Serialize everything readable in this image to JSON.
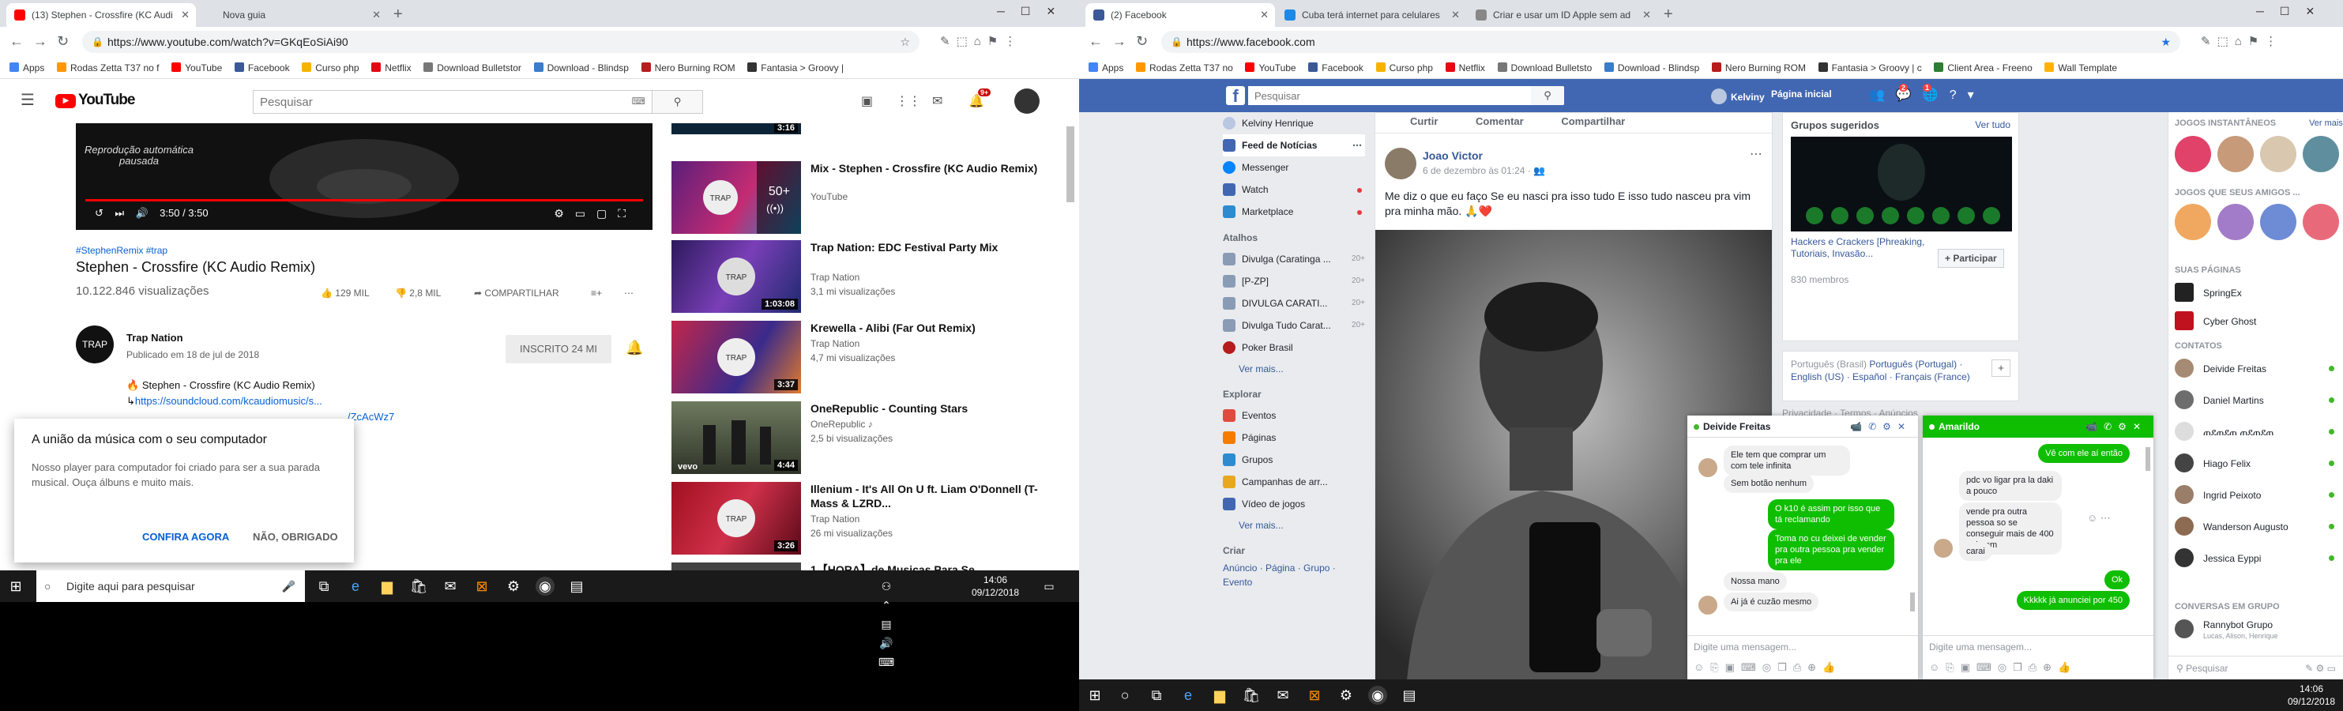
{
  "left_window": {
    "tabs": [
      {
        "label": "(13) Stephen - Crossfire (KC Audi",
        "active": true
      },
      {
        "label": "Nova guia",
        "active": false
      }
    ],
    "url": "https://www.youtube.com/watch?v=GKqEoSiAi90",
    "bookmarks": [
      "Apps",
      "Rodas Zetta T37 no f",
      "YouTube",
      "Facebook",
      "Curso php",
      "Netflix",
      "Download Bulletstor",
      "Download - Blindsp",
      "Nero Burning ROM",
      "Fantasia > Groovy |"
    ],
    "youtube": {
      "logo": "YouTube",
      "search_placeholder": "Pesquisar",
      "notifications": "9+",
      "player": {
        "autoplay_msg": "Reprodução automática pausada",
        "time": "3:50 / 3:50"
      },
      "hashtags": "#StephenRemix #trap",
      "title": "Stephen - Crossfire (KC Audio Remix)",
      "views": "10.122.846 visualizações",
      "likes": "129 MIL",
      "dislikes": "2,8 MIL",
      "share": "COMPARTILHAR",
      "channel": {
        "avatar_text": "TRAP",
        "name": "Trap Nation",
        "published": "Publicado em 18 de jul de 2018",
        "subscribe": "INSCRITO  24 MI"
      },
      "description": {
        "line1": "Stephen - Crossfire (KC Audio Remix)",
        "link1": "https://soundcloud.com/kcaudiomusic/s...",
        "link2": "/ZcAcWz7"
      },
      "recommendations": [
        {
          "title": "Mix - Stephen - Crossfire (KC Audio Remix)",
          "channel": "YouTube",
          "meta": "",
          "duration": "",
          "badge": "50+"
        },
        {
          "title": "Trap Nation: EDC Festival Party Mix",
          "channel": "Trap Nation",
          "meta": "3,1 mi visualizações",
          "duration": "1:03:08",
          "badge": ""
        },
        {
          "title": "Krewella - Alibi (Far Out Remix)",
          "channel": "Trap Nation",
          "meta": "4,7 mi visualizações",
          "duration": "3:37",
          "badge": ""
        },
        {
          "title": "OneRepublic - Counting Stars",
          "channel": "OneRepublic ♪",
          "meta": "2,5 bi visualizações",
          "duration": "4:44",
          "badge": ""
        },
        {
          "title": "Illenium - It's All On U ft. Liam O'Donnell (T-Mass & LZRD...",
          "channel": "Trap Nation",
          "meta": "26 mi visualizações",
          "duration": "3:26",
          "badge": ""
        },
        {
          "title": "1【HORA】de Musicas Para Se",
          "channel": "",
          "meta": "",
          "duration": "",
          "badge": ""
        }
      ],
      "top_duration": "3:16",
      "popup": {
        "title": "A união da música com o seu computador",
        "desc": "Nosso player para computador foi criado para ser a sua parada musical. Ouça álbuns e muito mais.",
        "confirm": "CONFIRA AGORA",
        "decline": "NÃO, OBRIGADO"
      }
    },
    "taskbar": {
      "search_placeholder": "Digite aqui para pesquisar",
      "time": "14:06",
      "date": "09/12/2018"
    }
  },
  "right_window": {
    "tabs": [
      {
        "label": "(2) Facebook",
        "active": true
      },
      {
        "label": "Cuba terá internet para celulares",
        "active": false
      },
      {
        "label": "Criar e usar um ID Apple sem ad",
        "active": false
      }
    ],
    "url": "https://www.facebook.com",
    "bookmarks": [
      "Apps",
      "Rodas Zetta T37 no",
      "YouTube",
      "Facebook",
      "Curso php",
      "Netflix",
      "Download Bulletsto",
      "Download - Blindsp",
      "Nero Burning ROM",
      "Fantasia > Groovy | c",
      "Client Area - Freeno",
      "Wall Template"
    ],
    "facebook": {
      "search_placeholder": "Pesquisar",
      "user_name": "Kelviny",
      "home": "Página inicial",
      "badges": {
        "friends": "",
        "messages": "2",
        "notifications": "1"
      },
      "left_nav": {
        "profile": "Kelviny Henrique",
        "items": [
          "Feed de Notícias",
          "Messenger",
          "Watch",
          "Marketplace"
        ],
        "shortcuts_header": "Atalhos",
        "shortcuts": [
          {
            "label": "Divulga (Caratinga ...",
            "count": "20+"
          },
          {
            "label": "[P-ZP]",
            "count": "20+"
          },
          {
            "label": "DIVULGA CARATI...",
            "count": "20+"
          },
          {
            "label": "Divulga Tudo Carat...",
            "count": "20+"
          },
          {
            "label": "Poker Brasil",
            "count": ""
          }
        ],
        "see_more": "Ver mais...",
        "explore_header": "Explorar",
        "explore": [
          "Eventos",
          "Páginas",
          "Grupos",
          "Campanhas de arr...",
          "Vídeo de jogos"
        ],
        "see_more2": "Ver mais...",
        "create_header": "Criar",
        "create": "Anúncio · Página · Grupo · Evento"
      },
      "post": {
        "top_actions": [
          "Curtir",
          "Comentar",
          "Compartilhar"
        ],
        "author": "Joao Victor",
        "date": "6 de dezembro às 01:24 · ",
        "text": "Me diz o que eu faço Se eu nasci pra isso tudo E isso tudo nasceu pra vim pra minha mão. 🙏❤️"
      },
      "groups": {
        "title": "Grupos sugeridos",
        "see_all": "Ver tudo",
        "group_name": "Hackers e Crackers [Phreaking, Tutoriais, Invasão...",
        "members": "830 membros",
        "join": "+ Participar"
      },
      "languages": {
        "current": "Português (Brasil)",
        "others": "Português (Portugal) · English (US) · Español · Français (France)"
      },
      "footer_links": "Privacidade · Termos · Anúncios",
      "chat_left": {
        "name": "Deivide Freitas",
        "messages": [
          {
            "dir": "in",
            "text": "Ele tem que comprar um com tele infinita"
          },
          {
            "dir": "in",
            "text": "Sem botão nenhum"
          },
          {
            "dir": "out",
            "text": "O k10 é assim por isso que tá reclamando"
          },
          {
            "dir": "out",
            "text": "Toma no cu deixei de vender pra outra pessoa pra vender pra ele"
          },
          {
            "dir": "in",
            "text": "Nossa mano"
          },
          {
            "dir": "in",
            "text": "Ai já é cuzão mesmo"
          }
        ],
        "input_placeholder": "Digite uma mensagem..."
      },
      "chat_right": {
        "name": "Amarildo",
        "messages": [
          {
            "dir": "out",
            "text": "Vê com ele aí então"
          },
          {
            "dir": "in",
            "text": "pdc vo ligar pra la daki a pouco"
          },
          {
            "dir": "in",
            "text": "vende pra outra pessoa so se conseguir mais de 400 nele em"
          },
          {
            "dir": "in",
            "text": "carai"
          },
          {
            "dir": "out",
            "text": "Ok"
          },
          {
            "dir": "out",
            "text": "Kkkkk já anunciei por 450"
          }
        ],
        "input_placeholder": "Digite uma mensagem..."
      },
      "sidebar": {
        "games_header": "JOGOS INSTANTÂNEOS",
        "games_see": "Ver mais",
        "friends_games_header": "JOGOS QUE SEUS AMIGOS ...",
        "pages_header": "SUAS PÁGINAS",
        "pages": [
          "SpringEx",
          "Cyber Ghost"
        ],
        "contacts_header": "CONTATOS",
        "contacts": [
          "Deivide Freitas",
          "Daniel Martins",
          "ጠደጠደጠ ጠደጠደጠ",
          "Hiago Felix",
          "Ingrid Peixoto",
          "Wanderson Augusto",
          "Jessica Eyppi"
        ],
        "group_header": "CONVERSAS EM GRUPO",
        "group": {
          "name": "Rannybot Grupo",
          "members": "Lucas, Alison, Henrique"
        },
        "search_placeholder": "Pesquisar"
      }
    },
    "taskbar": {
      "time": "14:06",
      "date": "09/12/2018"
    }
  },
  "colors": {
    "youtube_red": "#ff0000",
    "facebook_blue": "#4267b2",
    "messenger_green": "#0fbe00",
    "link_blue": "#065fd4"
  }
}
